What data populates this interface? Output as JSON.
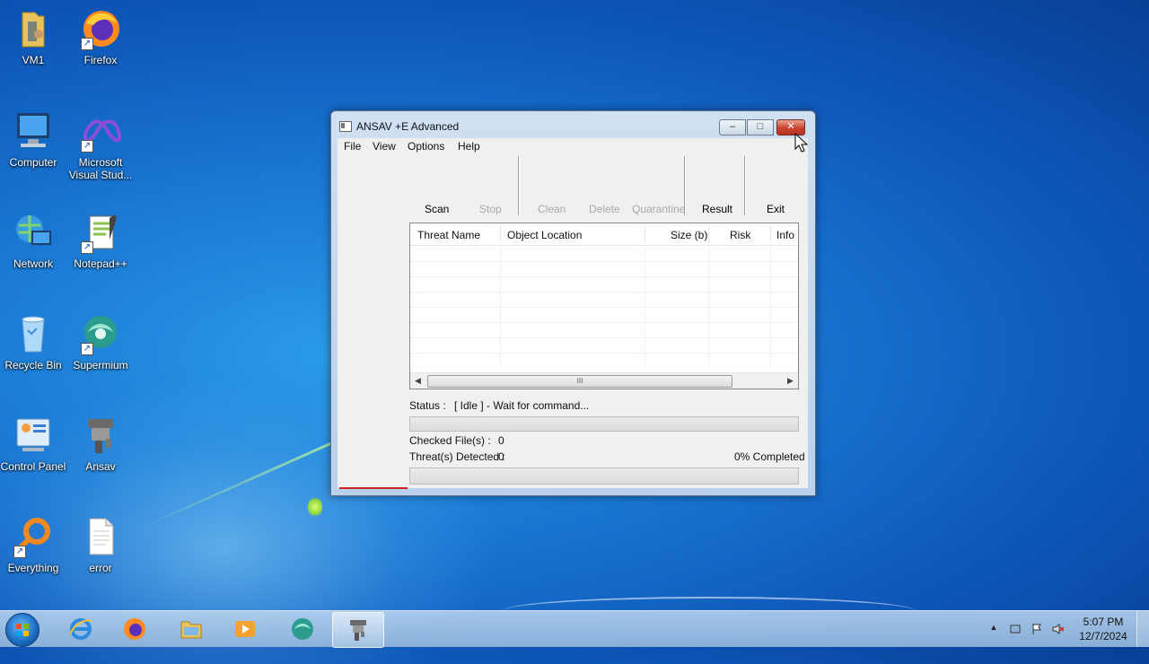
{
  "desktop": {
    "icons": [
      {
        "label": "VM1"
      },
      {
        "label": "Firefox"
      },
      {
        "label": "Computer"
      },
      {
        "label": "Microsoft Visual Stud..."
      },
      {
        "label": "Network"
      },
      {
        "label": "Notepad++"
      },
      {
        "label": "Recycle Bin"
      },
      {
        "label": "Supermium"
      },
      {
        "label": "Control Panel"
      },
      {
        "label": "Ansav"
      },
      {
        "label": "Everything"
      },
      {
        "label": "error"
      }
    ]
  },
  "window": {
    "title": "ANSAV +E Advanced",
    "controls": {
      "minimize": "–",
      "maximize": "□",
      "close": "✕"
    },
    "menu": [
      "File",
      "View",
      "Options",
      "Help"
    ],
    "toolbar": {
      "scan": "Scan",
      "stop": "Stop",
      "clean": "Clean",
      "delete": "Delete",
      "quarantine": "Quarantine",
      "result": "Result",
      "exit": "Exit"
    },
    "table": {
      "columns": [
        "Threat Name",
        "Object Location",
        "Size (b)",
        "Risk",
        "Info"
      ],
      "rows": [],
      "scroll_thumb_grip": "III"
    },
    "status_label": "Status  :",
    "status_value": "[ Idle ] - Wait for command...",
    "checked_files_label": "Checked File(s) :",
    "checked_files_value": "0",
    "threats_label": "Threat(s) Detected :",
    "threats_value": "0",
    "completed": "0% Completed",
    "progress_percent": 0
  },
  "taskbar": {
    "apps": [
      "internet-explorer",
      "firefox",
      "file-explorer",
      "media-player",
      "supermium",
      "ansav"
    ],
    "active_app": "ansav",
    "clock_time": "5:07 PM",
    "clock_date": "12/7/2024"
  },
  "colors": {
    "window_close": "#c9432f",
    "desktop": "#1a78d3"
  }
}
